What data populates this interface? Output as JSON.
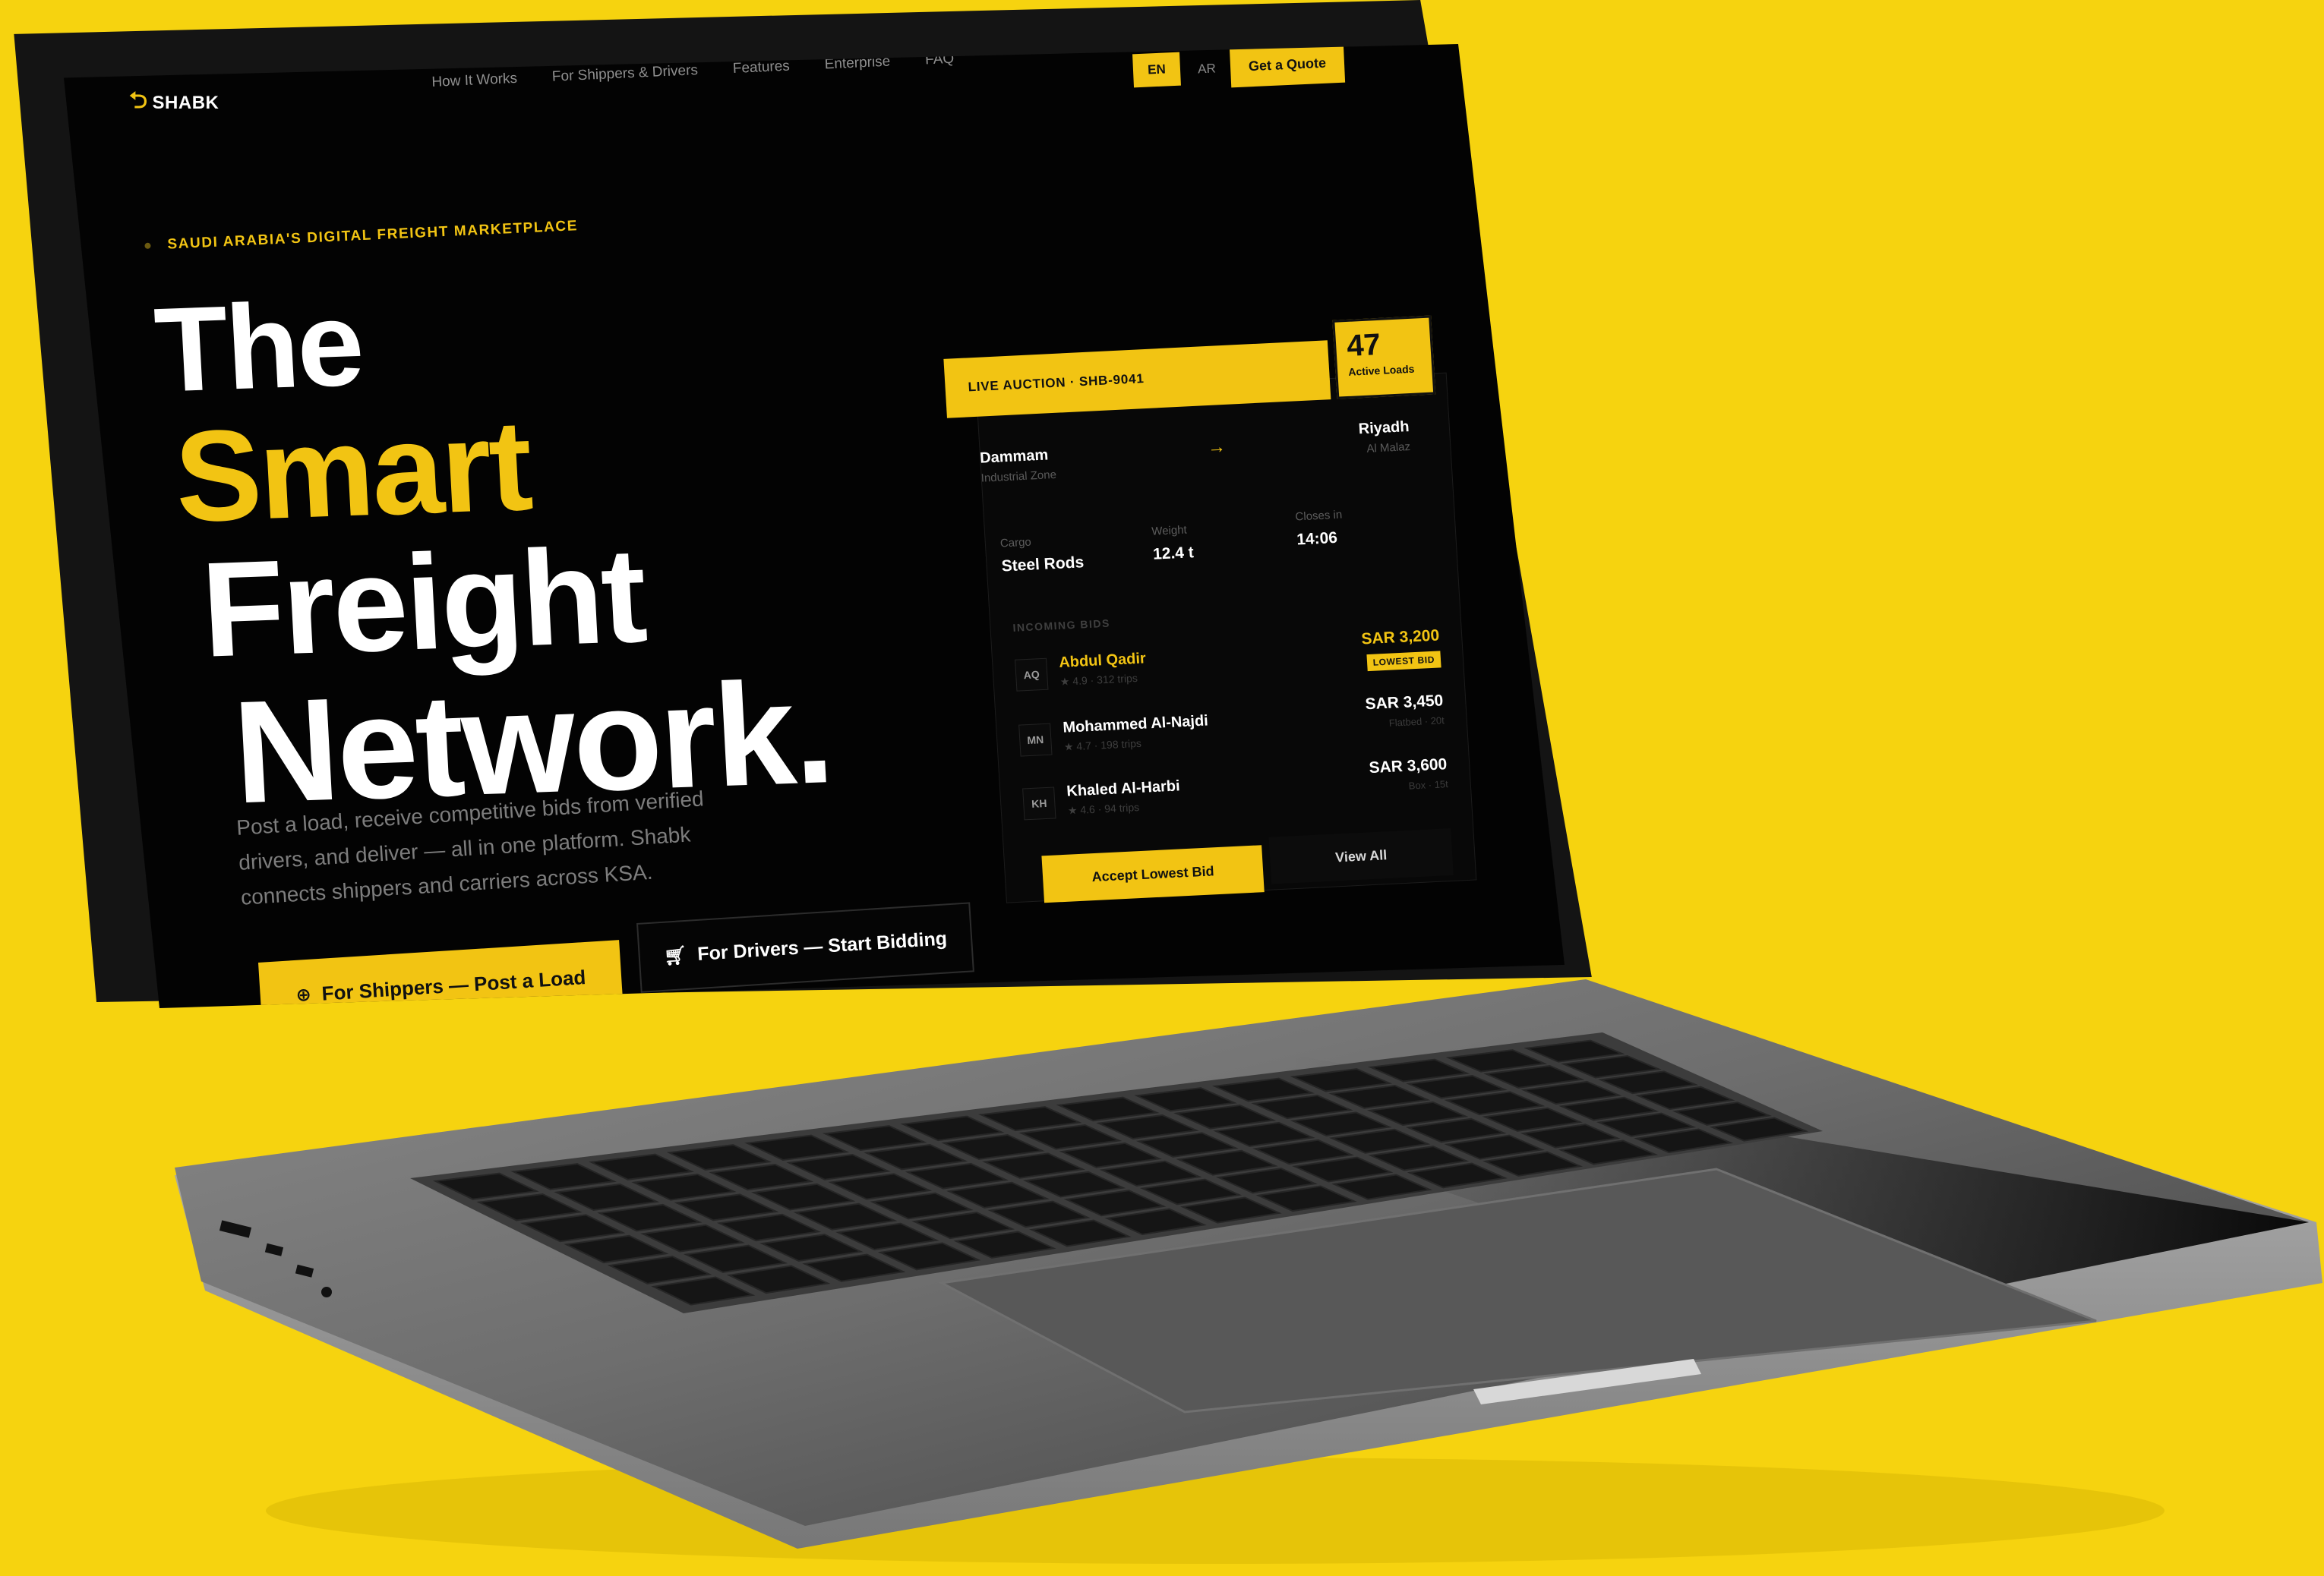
{
  "brand": {
    "name": "SHABK",
    "accent": "#F2C413",
    "background": "#F6D30F",
    "logo_icon": "cargo-flow-icon"
  },
  "nav": {
    "links": [
      "How It Works",
      "For Shippers & Drivers",
      "Features",
      "Enterprise",
      "FAQ"
    ],
    "lang_en": "EN",
    "lang_ar": "AR",
    "cta": "Get a Quote"
  },
  "hero": {
    "eyebrow": "SAUDI ARABIA'S DIGITAL FREIGHT MARKETPLACE",
    "line1": "The",
    "line2": "Smart",
    "line3": "Freight",
    "line4": "Network.",
    "subtext": "Post a load, receive competitive bids from verified drivers, and deliver — all in one platform. Shabk connects shippers and carriers across KSA.",
    "btn_shippers": "For Shippers — Post a Load",
    "btn_shippers_icon": "globe-icon",
    "btn_drivers": "For Drivers — Start Bidding",
    "btn_drivers_icon": "cart-icon"
  },
  "auction": {
    "header": "LIVE AUCTION · SHB-9041",
    "active_count": "47",
    "active_label": "Active Loads",
    "from_city": "Dammam",
    "from_zone": "Industrial Zone",
    "to_city": "Riyadh",
    "to_zone": "Al Malaz",
    "arrow": "→",
    "cargo_label": "Cargo",
    "cargo_value": "Steel Rods",
    "weight_label": "Weight",
    "weight_value": "12.4 t",
    "closes_label": "Closes in",
    "closes_value": "14:06",
    "bids_title": "INCOMING BIDS",
    "bids": [
      {
        "initials": "AQ",
        "name": "Abdul Qadir",
        "meta": "★ 4.9 · 312 trips",
        "amount": "SAR 3,200",
        "tag": "LOWEST BID"
      },
      {
        "initials": "MN",
        "name": "Mohammed Al-Najdi",
        "meta": "★ 4.7 · 198 trips",
        "amount": "SAR 3,450",
        "sub": "Flatbed · 20t"
      },
      {
        "initials": "KH",
        "name": "Khaled Al-Harbi",
        "meta": "★ 4.6 · 94 trips",
        "amount": "SAR 3,600",
        "sub": "Box · 15t"
      }
    ],
    "accept_label": "Accept Lowest Bid",
    "view_all_label": "View All"
  }
}
